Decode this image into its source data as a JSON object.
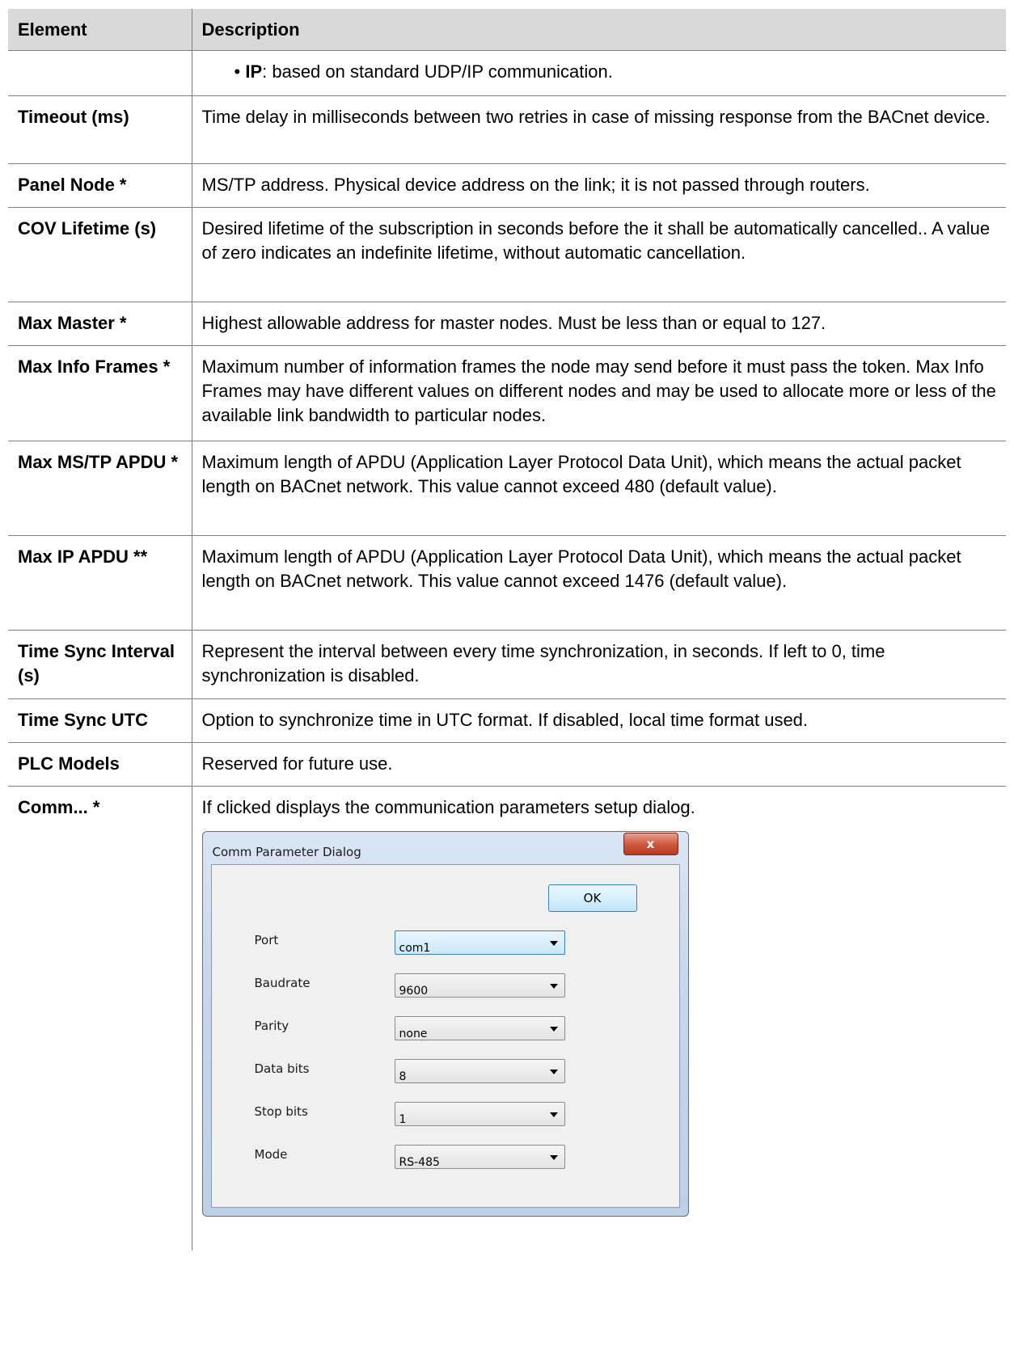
{
  "table": {
    "headers": {
      "element": "Element",
      "description": "Description"
    },
    "rows": [
      {
        "element": "",
        "bullet_term": "IP",
        "bullet_text": ": based on standard UDP/IP communication."
      },
      {
        "element": "Timeout (ms)",
        "description": "Time delay in milliseconds between two retries in case of missing response from the BACnet device."
      },
      {
        "element": "Panel Node *",
        "description": "MS/TP address. Physical device address on the link; it is not passed through routers."
      },
      {
        "element": "COV Lifetime (s)",
        "description": "Desired lifetime of the subscription in seconds before the it shall be automatically cancelled.. A value of zero indicates an indefinite lifetime, without automatic cancellation."
      },
      {
        "element": "Max Master *",
        "description": "Highest allowable address for master nodes. Must be less than or equal to 127."
      },
      {
        "element": "Max Info Frames *",
        "description": "Maximum number of information frames the node may send before it must pass the token. Max Info Frames may have different values on different nodes and may be used to allocate more or less of the available link bandwidth to particular nodes."
      },
      {
        "element": "Max MS/TP APDU *",
        "description": "Maximum length of APDU (Application Layer Protocol Data Unit), which means the actual packet length on BACnet network. This value cannot exceed 480 (default value)."
      },
      {
        "element": "Max IP APDU **",
        "description": "Maximum length of APDU (Application Layer Protocol Data Unit), which means the actual packet length on BACnet network. This value cannot exceed 1476 (default value)."
      },
      {
        "element": "Time Sync Interval (s)",
        "description": "Represent the interval between every time synchronization, in seconds. If left to 0, time synchronization is disabled."
      },
      {
        "element": "Time Sync UTC",
        "description": "Option to synchronize time in UTC format. If disabled, local time format used."
      },
      {
        "element": "PLC Models",
        "description": "Reserved for future use."
      },
      {
        "element": "Comm... *",
        "description": "If clicked displays the communication parameters setup dialog."
      }
    ]
  },
  "dialog": {
    "title": "Comm Parameter Dialog",
    "close_label": "x",
    "ok_label": "OK",
    "fields": [
      {
        "label": "Port",
        "value": "com1"
      },
      {
        "label": "Baudrate",
        "value": "9600"
      },
      {
        "label": "Parity",
        "value": "none"
      },
      {
        "label": "Data bits",
        "value": "8"
      },
      {
        "label": "Stop bits",
        "value": "1"
      },
      {
        "label": "Mode",
        "value": "RS-485"
      }
    ]
  }
}
